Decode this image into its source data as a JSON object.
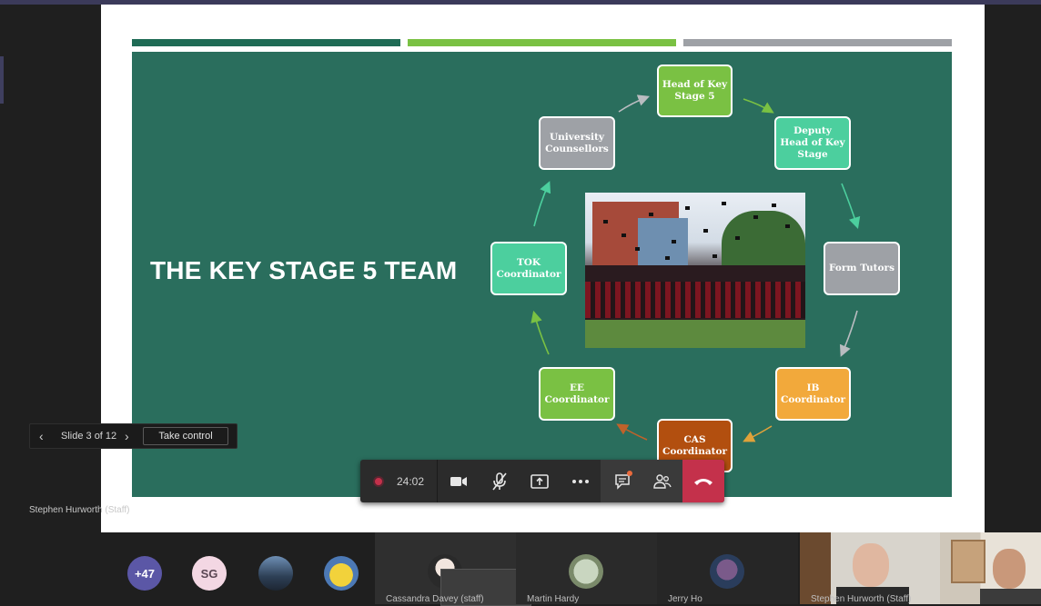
{
  "slide": {
    "title": "THE KEY STAGE 5 TEAM",
    "nodes": [
      {
        "id": "head",
        "label": "Head of Key Stage 5",
        "color": "#7ac143"
      },
      {
        "id": "deputy",
        "label": "Deputy Head of Key Stage",
        "color": "#4ccf9e"
      },
      {
        "id": "form",
        "label": "Form Tutors",
        "color": "#9ea1a6"
      },
      {
        "id": "ib",
        "label": "IB Coordinator",
        "color": "#f2a93b"
      },
      {
        "id": "cas",
        "label": "CAS Coordinator",
        "color": "#b24f0f"
      },
      {
        "id": "ee",
        "label": "EE Coordinator",
        "color": "#7ac143"
      },
      {
        "id": "tok",
        "label": "TOK Coordinator",
        "color": "#4ccf9e"
      },
      {
        "id": "univ",
        "label": "University Counsellors",
        "color": "#9ea1a6"
      }
    ],
    "stripe_colors": [
      "#1f6b55",
      "#7ac143",
      "#9ea1a6"
    ],
    "background": "#2a6e5d"
  },
  "slide_nav": {
    "counter": "Slide 3 of 12",
    "take_control": "Take control"
  },
  "presenter_label": "Stephen Hurworth (Staff)",
  "call_toolbar": {
    "timer": "24:02"
  },
  "participants": {
    "overflow": "+47",
    "initials": "SG",
    "names": [
      "Cassandra Davey (staff)",
      "Martin Hardy",
      "Jerry Ho",
      "Stephen Hurworth (Staff)"
    ]
  },
  "icons": [
    "chevron-left-icon",
    "chevron-right-icon",
    "record-icon",
    "camera-icon",
    "mic-off-icon",
    "share-tray-icon",
    "more-icon",
    "chat-icon",
    "participants-icon",
    "hang-up-icon"
  ]
}
